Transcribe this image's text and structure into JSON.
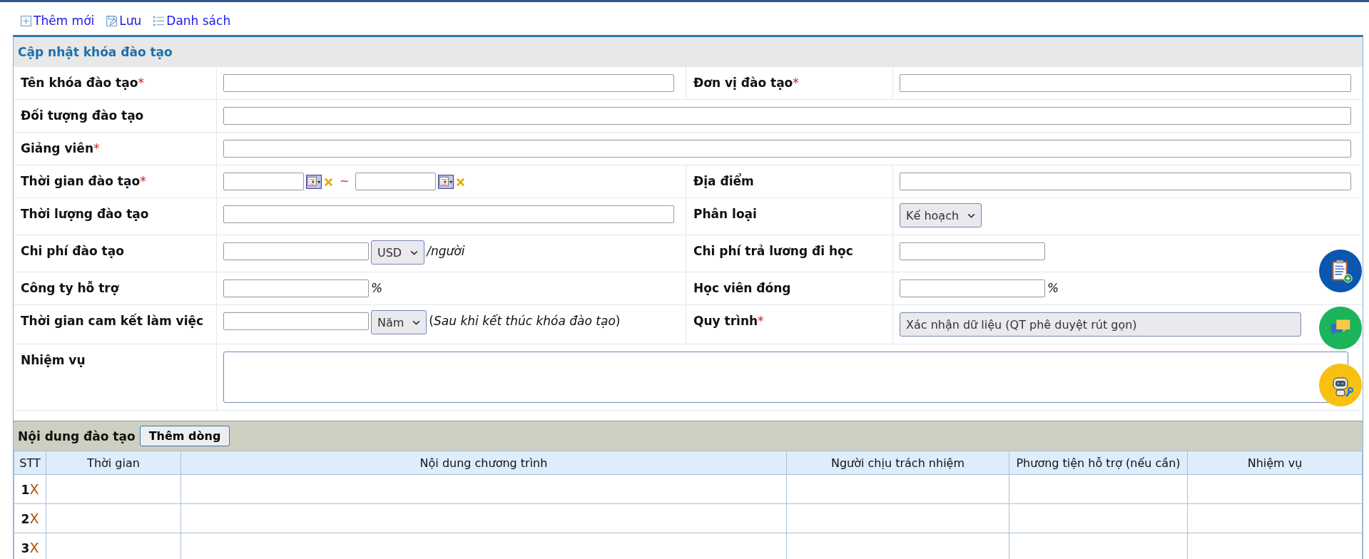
{
  "toolbar": [
    {
      "kind": "add",
      "label": "Thêm mới"
    },
    {
      "kind": "save",
      "label": "Lưu"
    },
    {
      "kind": "list",
      "label": "Danh sách"
    }
  ],
  "form": {
    "title": "Cập nhật khóa đào tạo",
    "rows": [
      {
        "fields": [
          {
            "label": "Tên khóa đào tạo",
            "required_mark": "*",
            "parts": [
              {
                "kind": "input"
              }
            ]
          },
          {
            "label": "Đơn vị đào tạo",
            "required_mark": "*",
            "parts": [
              {
                "kind": "input"
              }
            ]
          }
        ]
      },
      {
        "fields": [
          {
            "label": "Đối tượng đào tạo",
            "parts": [
              {
                "kind": "input"
              }
            ]
          }
        ]
      },
      {
        "fields": [
          {
            "label": "Giảng viên",
            "required_mark": "*",
            "parts": [
              {
                "kind": "input"
              }
            ]
          }
        ]
      },
      {
        "fields": [
          {
            "label": "Thời gian đào tạo",
            "required_mark": "*",
            "parts": [
              {
                "kind": "date"
              },
              {
                "kind": "calendar"
              },
              {
                "kind": "clear"
              },
              {
                "kind": "separator",
                "text": "~"
              },
              {
                "kind": "date"
              },
              {
                "kind": "calendar"
              },
              {
                "kind": "clear"
              }
            ]
          },
          {
            "label": "Địa điểm",
            "parts": [
              {
                "kind": "input"
              }
            ]
          }
        ]
      },
      {
        "fields": [
          {
            "label": "Thời lượng đào tạo",
            "parts": [
              {
                "kind": "input"
              }
            ]
          },
          {
            "label": "Phân loại",
            "parts": [
              {
                "kind": "select",
                "value": "Kế hoạch"
              }
            ]
          }
        ]
      },
      {
        "fields": [
          {
            "label": "Chi phí đào tạo",
            "parts": [
              {
                "kind": "short-input"
              },
              {
                "kind": "select",
                "value": "USD"
              },
              {
                "kind": "suffix",
                "text": "*/người*"
              }
            ]
          },
          {
            "label": "Chi phí trả lương đi học",
            "parts": [
              {
                "kind": "short-input"
              }
            ]
          }
        ]
      },
      {
        "fields": [
          {
            "label": "Công ty hỗ trợ",
            "parts": [
              {
                "kind": "short-input"
              },
              {
                "kind": "suffix",
                "text": "*%*"
              }
            ]
          },
          {
            "label": "Học viên đóng",
            "parts": [
              {
                "kind": "short-input"
              },
              {
                "kind": "suffix",
                "text": "*%*"
              }
            ]
          }
        ]
      },
      {
        "fields": [
          {
            "label": "Thời gian cam kết làm việc",
            "parts": [
              {
                "kind": "short-input"
              },
              {
                "kind": "select",
                "value": "Năm"
              },
              {
                "kind": "suffix",
                "text": "(*Sau khi kết thúc khóa đào tạo*)"
              }
            ]
          },
          {
            "label": "Quy trình",
            "required_mark": "*",
            "parts": [
              {
                "kind": "locked-select",
                "value": "Xác nhận dữ liệu (QT phê duyệt rút gọn)"
              }
            ]
          }
        ]
      },
      {
        "fields": [
          {
            "label": "Nhiệm vụ",
            "parts": [
              {
                "kind": "textarea"
              }
            ]
          }
        ]
      }
    ]
  },
  "training_content": {
    "title": "Nội dung đào tạo",
    "add_button": "Thêm dòng",
    "columns": [
      "STT",
      "Thời gian",
      "Nội dung chương trình",
      "Người chịu trách nhiệm",
      "Phương tiện hỗ trợ (nếu cần)",
      "Nhiệm vụ"
    ],
    "rows": [
      {
        "stt": "1",
        "delete": "X"
      },
      {
        "stt": "2",
        "delete": "X"
      },
      {
        "stt": "3",
        "delete": "X"
      }
    ]
  }
}
